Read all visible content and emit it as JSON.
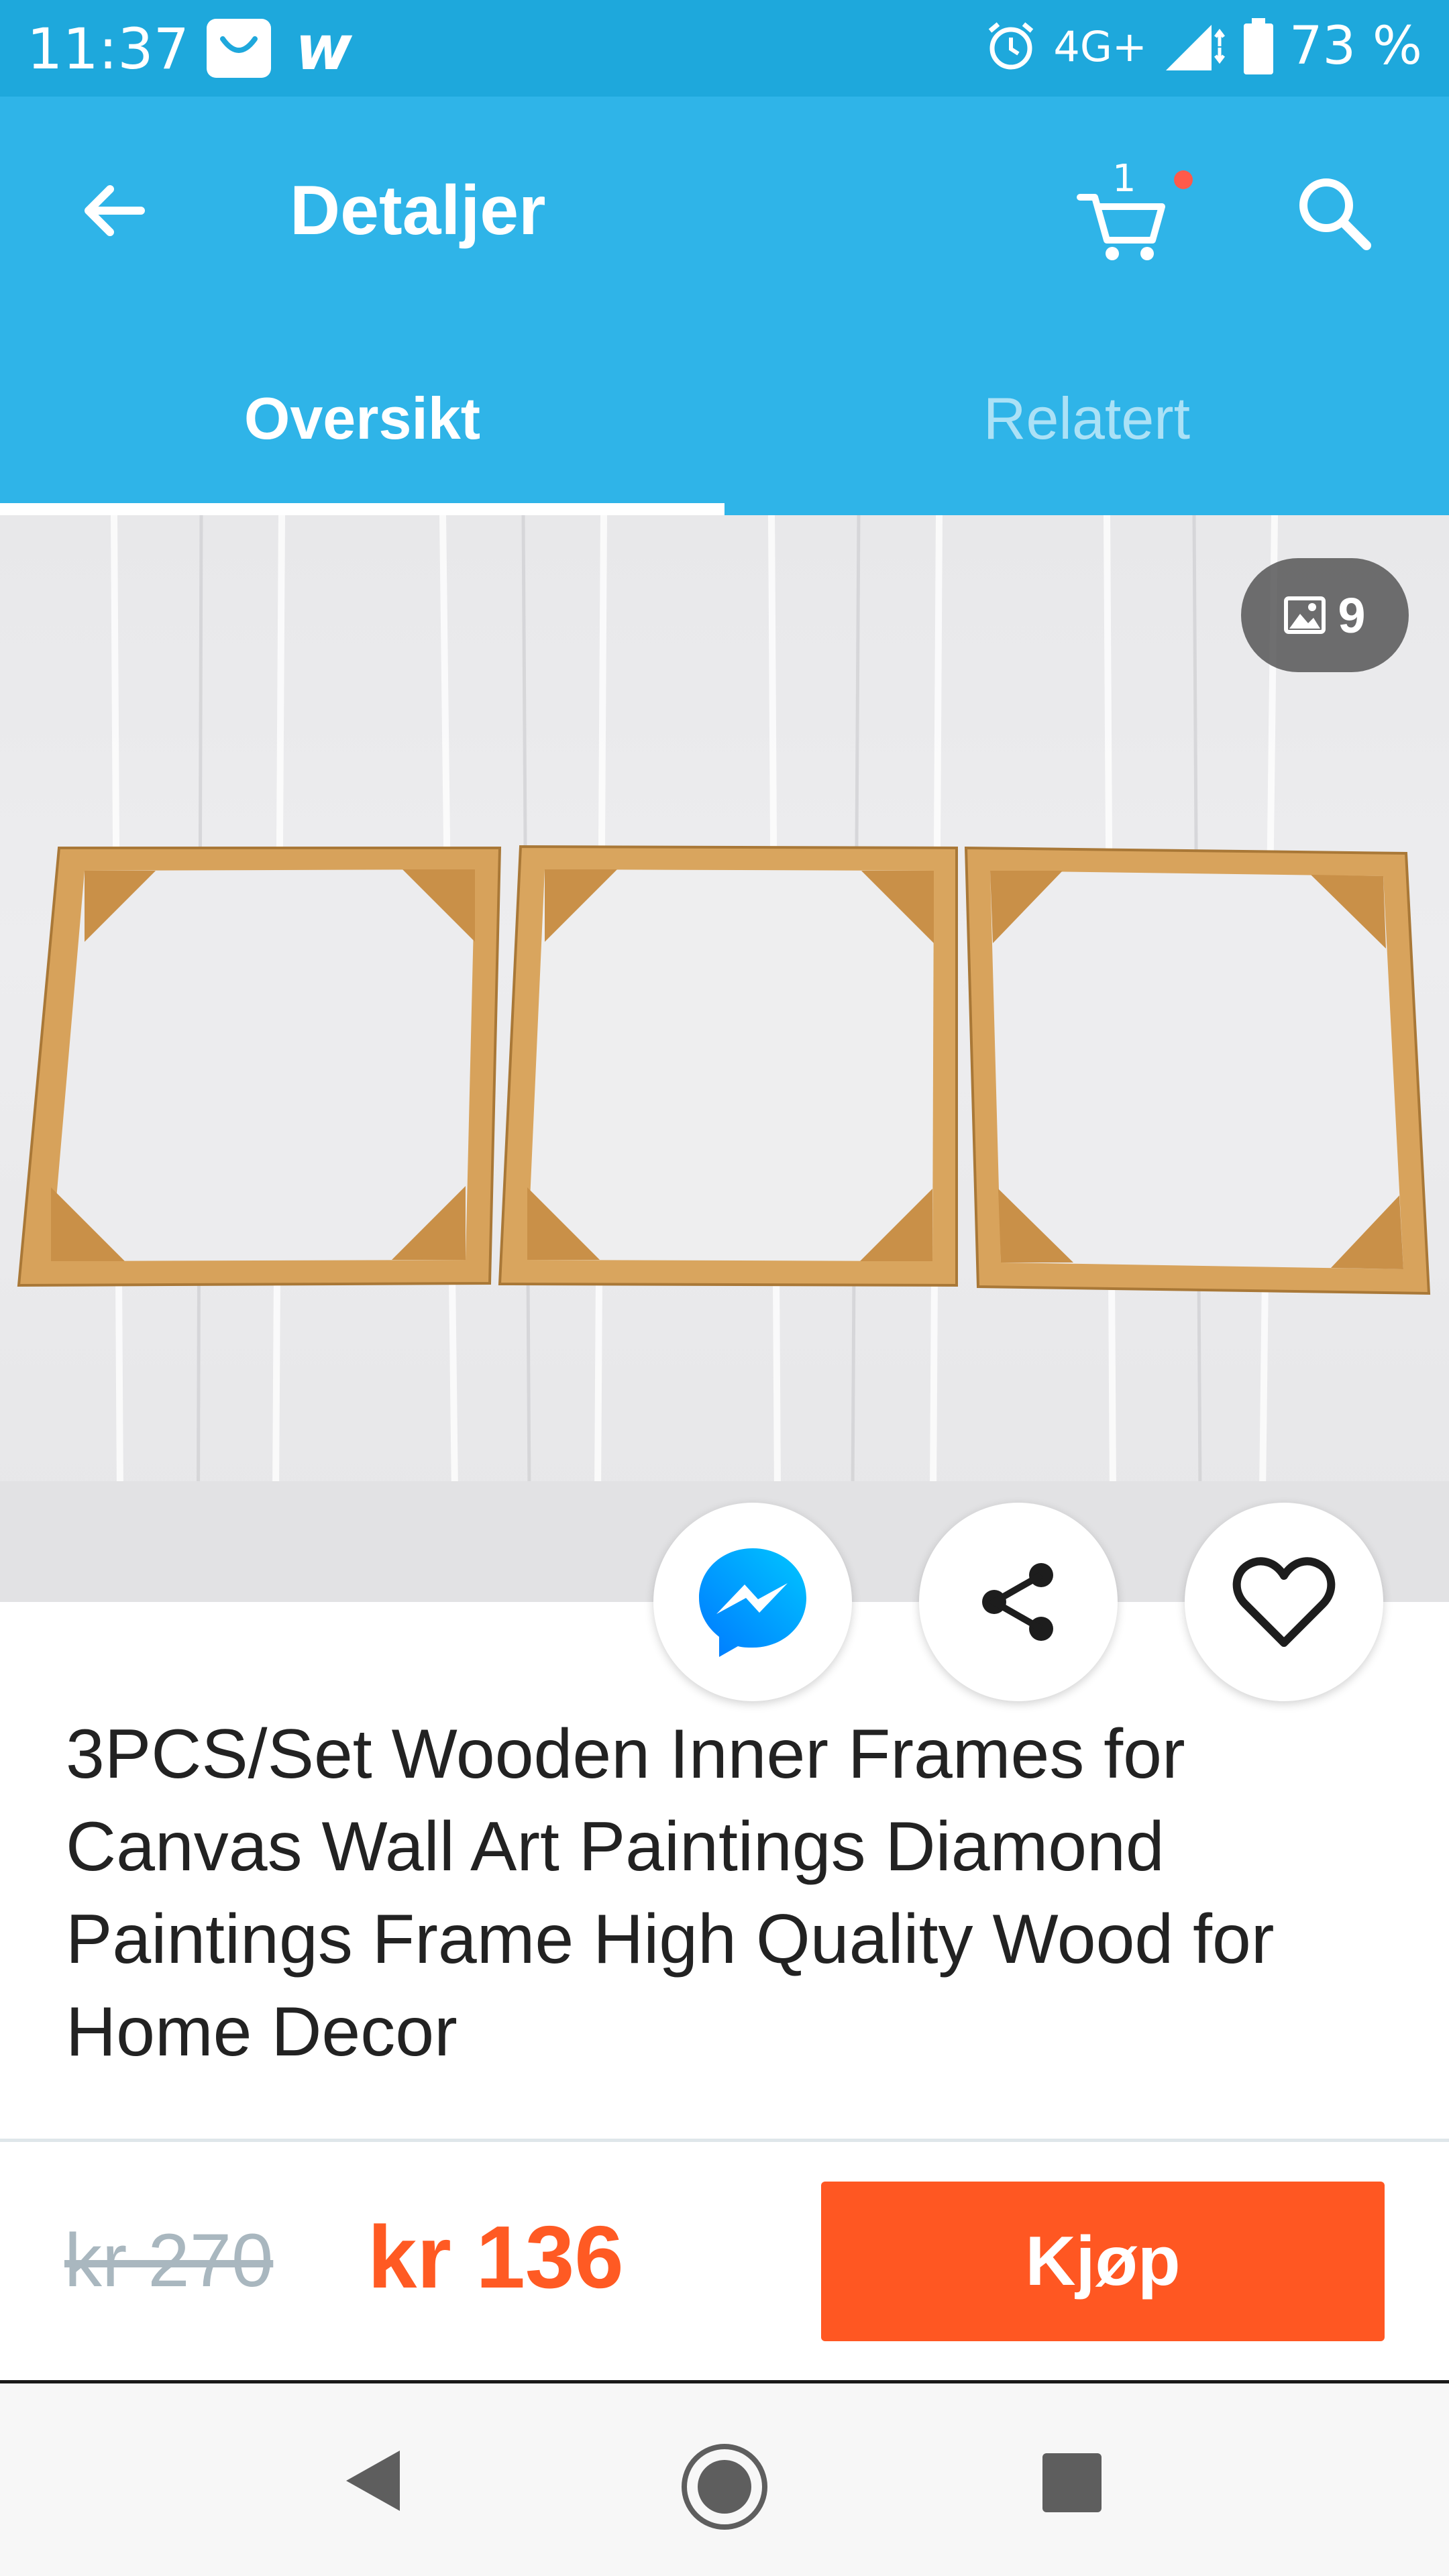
{
  "status_bar": {
    "time": "11:37",
    "network": "4G+",
    "battery": "73 %",
    "icons": [
      "shopping-bag-icon",
      "wish-app-icon",
      "alarm-icon",
      "signal-icon",
      "battery-icon"
    ]
  },
  "header": {
    "title": "Detaljer",
    "cart_count": "1",
    "icons": [
      "back-arrow-icon",
      "cart-icon",
      "search-icon"
    ]
  },
  "tabs": [
    {
      "label": "Oversikt",
      "active": true
    },
    {
      "label": "Relatert",
      "active": false
    }
  ],
  "gallery": {
    "photo_count": "9"
  },
  "actions": [
    "messenger-icon",
    "share-icon",
    "heart-icon"
  ],
  "product": {
    "title": "3PCS/Set Wooden Inner Frames for Canvas Wall Art Paintings Diamond Paintings Frame High Quality Wood for Home Decor",
    "price_old": "kr 270",
    "price_new": "kr 136",
    "buy_label": "Kjøp"
  },
  "colors": {
    "status_bar": "#1ea8dc",
    "app_bar": "#2fb4e8",
    "accent": "#ff5722",
    "price": "#ff5a23"
  }
}
